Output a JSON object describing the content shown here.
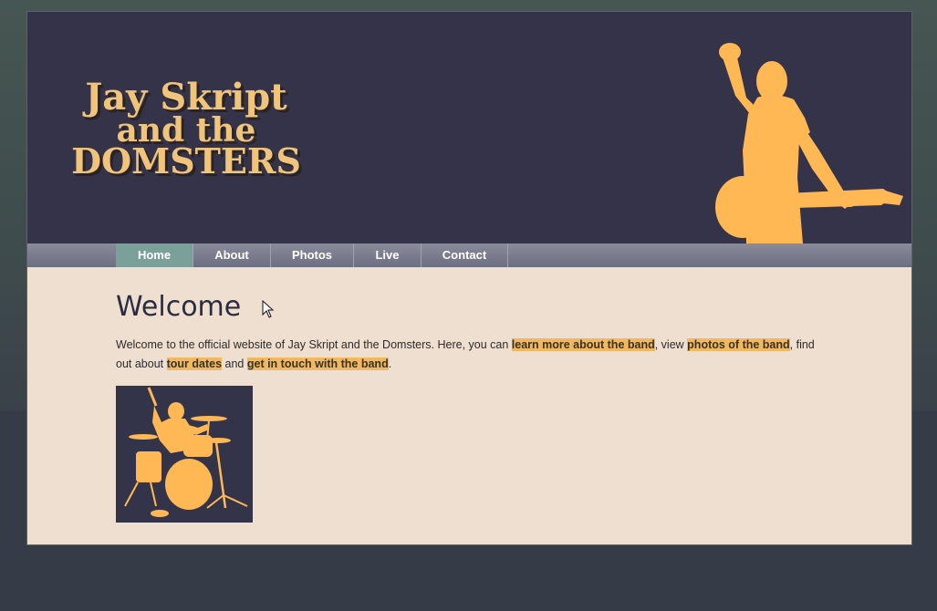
{
  "logo": {
    "line1": "Jay Skript",
    "line2": "and the",
    "line3": "DOMSTERS"
  },
  "nav": {
    "items": [
      {
        "label": "Home",
        "active": true
      },
      {
        "label": "About",
        "active": false
      },
      {
        "label": "Photos",
        "active": false
      },
      {
        "label": "Live",
        "active": false
      },
      {
        "label": "Contact",
        "active": false
      }
    ]
  },
  "main": {
    "heading": "Welcome",
    "intro": {
      "t1": "Welcome to the official website of Jay Skript and the Domsters. Here, you can ",
      "link_about": "learn more about the band",
      "t2": ", view ",
      "link_photos": "photos of the band",
      "t3": ", find out about ",
      "link_live": "tour dates",
      "t4": " and ",
      "link_contact": "get in touch with the band",
      "t5": "."
    }
  },
  "colors": {
    "header_bg": "#34334a",
    "accent": "#ffb854",
    "content_bg": "#efdfd0",
    "nav_active": "#7ba09a",
    "link_highlight": "#f0b860"
  },
  "icons": {
    "header_image": "guitarist-silhouette",
    "content_image": "drummer-silhouette",
    "pointer": "mouse-cursor-icon"
  }
}
